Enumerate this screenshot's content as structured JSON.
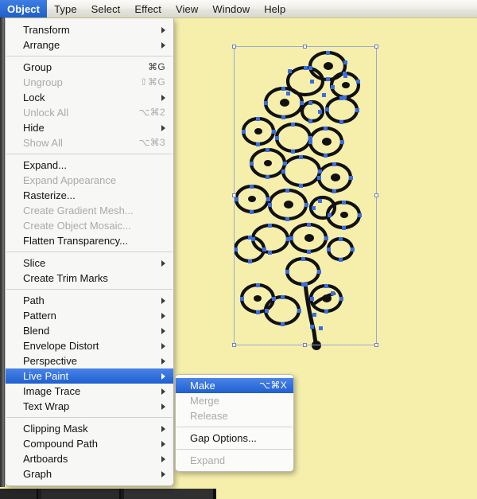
{
  "app": {
    "name": "Adobe Illustrator",
    "canvas_background": "#f6efac"
  },
  "menubar": {
    "items": [
      {
        "label": "Object",
        "active": true
      },
      {
        "label": "Type",
        "active": false
      },
      {
        "label": "Select",
        "active": false
      },
      {
        "label": "Effect",
        "active": false
      },
      {
        "label": "View",
        "active": false
      },
      {
        "label": "Window",
        "active": false
      },
      {
        "label": "Help",
        "active": false
      }
    ],
    "highlight_color": "#2f6fd8"
  },
  "object_menu": {
    "title": "Object",
    "groups": [
      {
        "items": [
          {
            "label": "Transform",
            "shortcut": "",
            "submenu": true,
            "disabled": false,
            "selected": false
          },
          {
            "label": "Arrange",
            "shortcut": "",
            "submenu": true,
            "disabled": false,
            "selected": false
          }
        ]
      },
      {
        "items": [
          {
            "label": "Group",
            "shortcut": "⌘G",
            "submenu": false,
            "disabled": false,
            "selected": false
          },
          {
            "label": "Ungroup",
            "shortcut": "⇧⌘G",
            "submenu": false,
            "disabled": true,
            "selected": false
          },
          {
            "label": "Lock",
            "shortcut": "",
            "submenu": true,
            "disabled": false,
            "selected": false
          },
          {
            "label": "Unlock All",
            "shortcut": "⌥⌘2",
            "submenu": false,
            "disabled": true,
            "selected": false
          },
          {
            "label": "Hide",
            "shortcut": "",
            "submenu": true,
            "disabled": false,
            "selected": false
          },
          {
            "label": "Show All",
            "shortcut": "⌥⌘3",
            "submenu": false,
            "disabled": true,
            "selected": false
          }
        ]
      },
      {
        "items": [
          {
            "label": "Expand...",
            "shortcut": "",
            "submenu": false,
            "disabled": false,
            "selected": false
          },
          {
            "label": "Expand Appearance",
            "shortcut": "",
            "submenu": false,
            "disabled": true,
            "selected": false
          },
          {
            "label": "Rasterize...",
            "shortcut": "",
            "submenu": false,
            "disabled": false,
            "selected": false
          },
          {
            "label": "Create Gradient Mesh...",
            "shortcut": "",
            "submenu": false,
            "disabled": true,
            "selected": false
          },
          {
            "label": "Create Object Mosaic...",
            "shortcut": "",
            "submenu": false,
            "disabled": true,
            "selected": false
          },
          {
            "label": "Flatten Transparency...",
            "shortcut": "",
            "submenu": false,
            "disabled": false,
            "selected": false
          }
        ]
      },
      {
        "items": [
          {
            "label": "Slice",
            "shortcut": "",
            "submenu": true,
            "disabled": false,
            "selected": false
          },
          {
            "label": "Create Trim Marks",
            "shortcut": "",
            "submenu": false,
            "disabled": false,
            "selected": false
          }
        ]
      },
      {
        "items": [
          {
            "label": "Path",
            "shortcut": "",
            "submenu": true,
            "disabled": false,
            "selected": false
          },
          {
            "label": "Pattern",
            "shortcut": "",
            "submenu": true,
            "disabled": false,
            "selected": false
          },
          {
            "label": "Blend",
            "shortcut": "",
            "submenu": true,
            "disabled": false,
            "selected": false
          },
          {
            "label": "Envelope Distort",
            "shortcut": "",
            "submenu": true,
            "disabled": false,
            "selected": false
          },
          {
            "label": "Perspective",
            "shortcut": "",
            "submenu": true,
            "disabled": false,
            "selected": false
          },
          {
            "label": "Live Paint",
            "shortcut": "",
            "submenu": true,
            "disabled": false,
            "selected": true
          },
          {
            "label": "Image Trace",
            "shortcut": "",
            "submenu": true,
            "disabled": false,
            "selected": false
          },
          {
            "label": "Text Wrap",
            "shortcut": "",
            "submenu": true,
            "disabled": false,
            "selected": false
          }
        ]
      },
      {
        "items": [
          {
            "label": "Clipping Mask",
            "shortcut": "",
            "submenu": true,
            "disabled": false,
            "selected": false
          },
          {
            "label": "Compound Path",
            "shortcut": "",
            "submenu": true,
            "disabled": false,
            "selected": false
          },
          {
            "label": "Artboards",
            "shortcut": "",
            "submenu": true,
            "disabled": false,
            "selected": false
          },
          {
            "label": "Graph",
            "shortcut": "",
            "submenu": true,
            "disabled": false,
            "selected": false
          }
        ]
      }
    ]
  },
  "live_paint_submenu": {
    "parent": "Live Paint",
    "groups": [
      {
        "items": [
          {
            "label": "Make",
            "shortcut": "⌥⌘X",
            "disabled": false,
            "selected": true
          },
          {
            "label": "Merge",
            "shortcut": "",
            "disabled": true,
            "selected": false
          },
          {
            "label": "Release",
            "shortcut": "",
            "disabled": true,
            "selected": false
          }
        ]
      },
      {
        "items": [
          {
            "label": "Gap Options...",
            "shortcut": "",
            "disabled": false,
            "selected": false
          }
        ]
      },
      {
        "items": [
          {
            "label": "Expand",
            "shortcut": "",
            "disabled": true,
            "selected": false
          }
        ]
      }
    ]
  },
  "artwork": {
    "description": "grape-cluster line drawing with selected paths",
    "stroke_color": "#111111",
    "anchor_color": "#3b6fe0",
    "selection_border_color": "#9aa9cf",
    "handle_fill": "#ffffff",
    "selected": true
  }
}
